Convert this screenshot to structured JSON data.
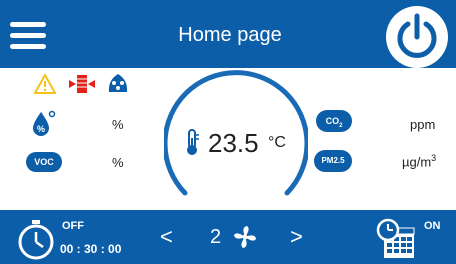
{
  "header": {
    "title": "Home page",
    "menu_icon": "hamburger-menu-icon",
    "power_icon": "power-icon"
  },
  "status_icons": [
    "warning-icon",
    "heat-recovery-icon",
    "filter-icon"
  ],
  "readings": {
    "humidity_unit": "%",
    "voc_icon_text": "VOC",
    "voc_unit": "%",
    "co2_icon_text": "CO",
    "co2_sub": "2",
    "co2_unit": "ppm",
    "pm25_icon_text": "PM2.5",
    "pm25_unit": "µg/m",
    "pm25_unit_sup": "3"
  },
  "temperature": {
    "value": "23.5",
    "unit": "°C"
  },
  "footer": {
    "timer_state": "OFF",
    "timer_time": "00 : 30 : 00",
    "fan_speed": "2",
    "schedule_state": "ON",
    "prev_symbol": "<",
    "next_symbol": ">"
  },
  "colors": {
    "primary": "#0d5ea8",
    "accent_cyan": "#1aa7e0",
    "warning_yellow": "#f5c21b",
    "alert_red": "#e2231a"
  }
}
